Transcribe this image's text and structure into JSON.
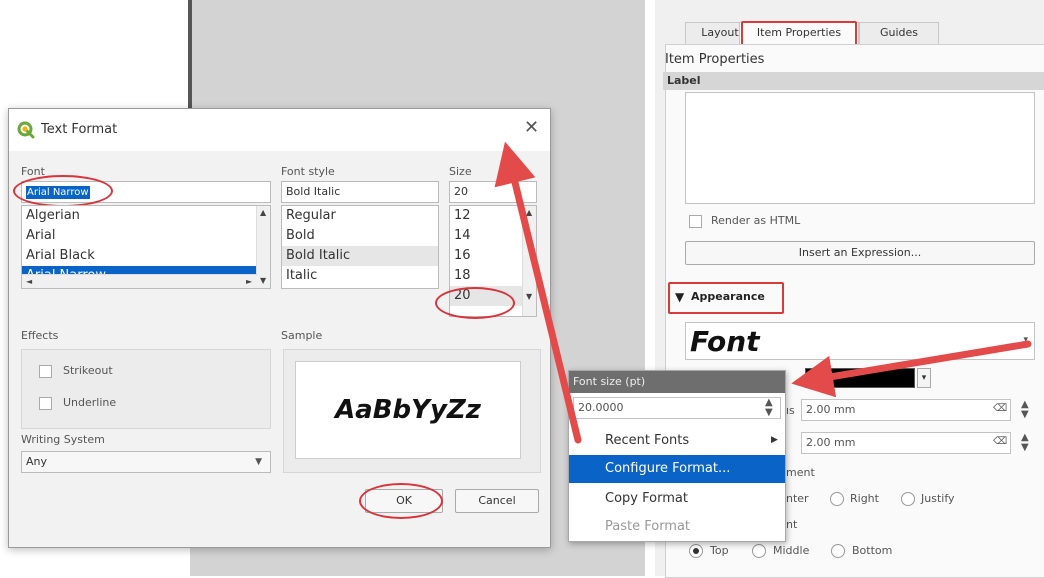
{
  "panel": {
    "tabs": [
      "Layout",
      "Item Properties",
      "Guides"
    ],
    "section_title": "Item Properties",
    "group_header": "Label",
    "render_html_label": "Render as HTML",
    "insert_expression_button": "Insert an Expression...",
    "appearance_label": "Appearance",
    "font_preview": "Font",
    "margin_h_suffix": "ıs",
    "margin_h_value": "2.00 mm",
    "margin_v_value": "2.00 mm",
    "h_align_partial": "ment",
    "h_align_options": [
      "nter",
      "Right",
      "Justify"
    ],
    "v_align_partial": "nt",
    "v_align_options": [
      "Top",
      "Middle",
      "Bottom"
    ]
  },
  "dialog": {
    "title": "Text Format",
    "font_label": "Font",
    "font_value": "Arial Narrow",
    "font_list": [
      "Algerian",
      "Arial",
      "Arial Black",
      "Arial Narrow"
    ],
    "font_selected_index": 3,
    "style_label": "Font style",
    "style_value": "Bold Italic",
    "style_list": [
      "Regular",
      "Bold",
      "Bold Italic",
      "Italic"
    ],
    "size_label": "Size",
    "size_value": "20",
    "size_list": [
      "12",
      "14",
      "16",
      "18",
      "20"
    ],
    "effects_label": "Effects",
    "strikeout_label": "Strikeout",
    "underline_label": "Underline",
    "sample_label": "Sample",
    "sample_text": "AaBbYyZz",
    "writing_system_label": "Writing System",
    "writing_system_value": "Any",
    "ok_button": "OK",
    "cancel_button": "Cancel"
  },
  "popup": {
    "header": "Font size (pt)",
    "size_value": "20.0000",
    "items": [
      "Recent Fonts",
      "Configure Format...",
      "Copy Format",
      "Paste Format"
    ],
    "active_index": 1,
    "disabled_index": 3
  },
  "colors": {
    "accent_red": "#d93a3a",
    "selection_blue": "#0a64c8"
  }
}
